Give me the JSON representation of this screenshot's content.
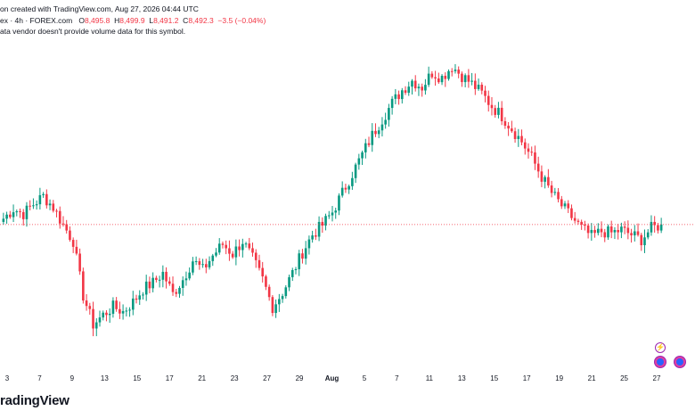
{
  "header": {
    "source_line": "on created with TradingView.com, Aug 27, 2026 04:44 UTC",
    "symbol_line": "ex · 4h · FOREX.com",
    "ohlc": [
      {
        "k": "O",
        "v": "8,495.8"
      },
      {
        "k": "H",
        "v": "8,499.9"
      },
      {
        "k": "L",
        "v": "8,491.2"
      },
      {
        "k": "C",
        "v": "8,492.3"
      }
    ],
    "change": "−3.5 (−0.04%)",
    "notice": "ata vendor doesn't provide volume data for this symbol."
  },
  "logo": {
    "text": "radingView"
  },
  "badges": {
    "lightning": "⚡"
  },
  "colors": {
    "up": "#089981",
    "down": "#f23645",
    "last_price_line": "#f23645",
    "text": "#131722"
  },
  "chart_data": {
    "type": "candlestick",
    "interval": "4h",
    "x_axis_labels": [
      "3",
      "7",
      "9",
      "13",
      "15",
      "17",
      "21",
      "23",
      "27",
      "29",
      "Aug",
      "5",
      "7",
      "11",
      "13",
      "15",
      "17",
      "19",
      "21",
      "25",
      "27"
    ],
    "y_axis": "hidden",
    "last_price": 8492.3,
    "last_price_line": "dotted",
    "grid": false,
    "close_trend": [
      8496,
      8502,
      8499,
      8505,
      8510,
      8503,
      8492,
      8482,
      8448,
      8430,
      8436,
      8441,
      8438,
      8444,
      8452,
      8456,
      8462,
      8449,
      8458,
      8470,
      8464,
      8473,
      8480,
      8474,
      8482,
      8471,
      8458,
      8441,
      8450,
      8462,
      8475,
      8486,
      8492,
      8500,
      8512,
      8524,
      8536,
      8548,
      8558,
      8568,
      8576,
      8582,
      8578,
      8587,
      8584,
      8591,
      8585,
      8580,
      8574,
      8566,
      8560,
      8552,
      8544,
      8534,
      8522,
      8512,
      8504,
      8497,
      8490,
      8485,
      8488,
      8487,
      8489,
      8486,
      8483,
      8490,
      8492
    ]
  }
}
